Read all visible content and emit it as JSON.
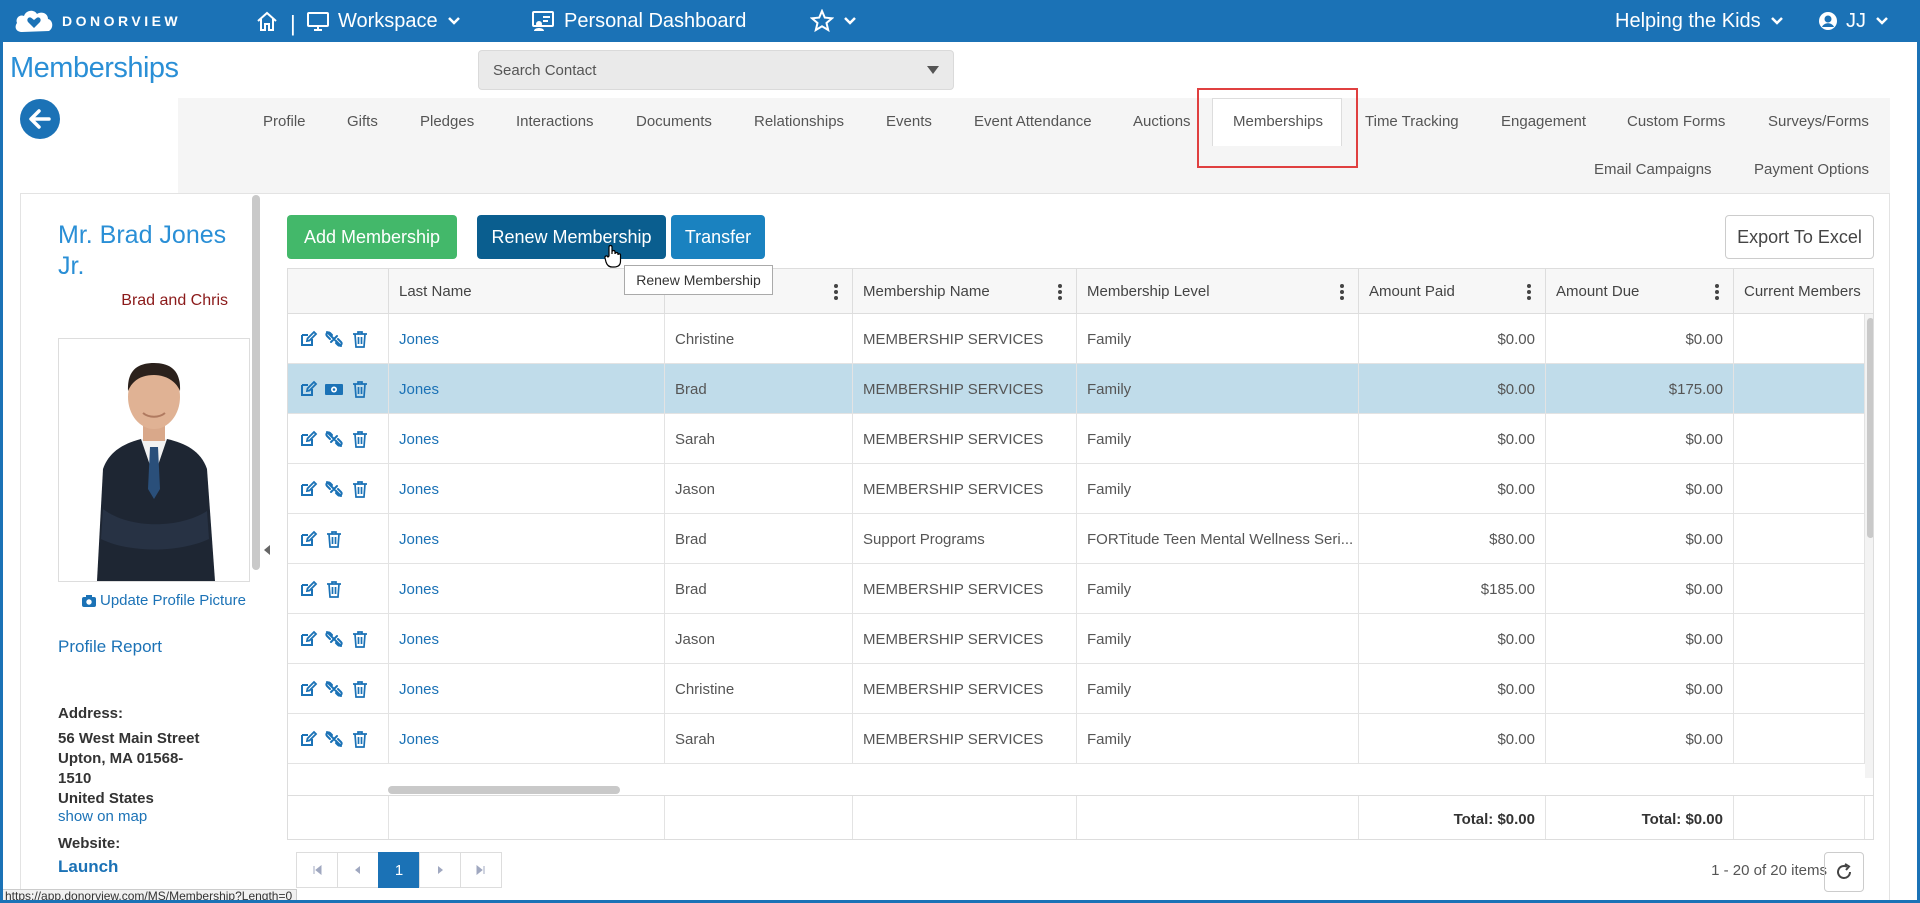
{
  "app": {
    "logo_text": "DONORVIEW",
    "workspace_label": "Workspace",
    "dashboard_label": "Personal Dashboard",
    "org_name": "Helping the Kids",
    "user_initials": "JJ",
    "separator": "|"
  },
  "page": {
    "title": "Memberships",
    "search_placeholder": "Search Contact"
  },
  "tabs": [
    {
      "label": "Profile"
    },
    {
      "label": "Gifts"
    },
    {
      "label": "Pledges"
    },
    {
      "label": "Interactions"
    },
    {
      "label": "Documents"
    },
    {
      "label": "Relationships"
    },
    {
      "label": "Events"
    },
    {
      "label": "Event Attendance"
    },
    {
      "label": "Auctions"
    },
    {
      "label": "Memberships"
    },
    {
      "label": "Time Tracking"
    },
    {
      "label": "Engagement"
    },
    {
      "label": "Custom Forms"
    },
    {
      "label": "Surveys/Forms"
    },
    {
      "label": "Email Campaigns"
    },
    {
      "label": "Payment Options"
    }
  ],
  "profile": {
    "name_line1": "Mr. Brad Jones",
    "name_line2": "Jr.",
    "nickname": "Brad and Chris",
    "update_picture": "Update Profile Picture",
    "profile_report": "Profile Report",
    "address_label": "Address:",
    "address_line1": "56 West Main Street",
    "address_line2": "Upton, MA 01568-",
    "address_line3": "1510",
    "address_line4": "United States",
    "show_on_map": "show on map",
    "website_label": "Website:",
    "website_link": "Launch"
  },
  "toolbar": {
    "add": "Add Membership",
    "renew": "Renew Membership",
    "transfer": "Transfer",
    "export": "Export To Excel",
    "tooltip": "Renew Membership"
  },
  "grid": {
    "headers": [
      "Last Name",
      "",
      "Membership Name",
      "Membership Level",
      "Amount Paid",
      "Amount Due",
      "Current Members"
    ],
    "rows": [
      {
        "icons": "edit-unlink-delete",
        "last": "Jones",
        "first": "Christine",
        "name": "MEMBERSHIP SERVICES",
        "level": "Family",
        "paid": "$0.00",
        "due": "$0.00"
      },
      {
        "icons": "edit-money-delete",
        "last": "Jones",
        "first": "Brad",
        "name": "MEMBERSHIP SERVICES",
        "level": "Family",
        "paid": "$0.00",
        "due": "$175.00",
        "selected": true
      },
      {
        "icons": "edit-unlink-delete",
        "last": "Jones",
        "first": "Sarah",
        "name": "MEMBERSHIP SERVICES",
        "level": "Family",
        "paid": "$0.00",
        "due": "$0.00"
      },
      {
        "icons": "edit-unlink-delete",
        "last": "Jones",
        "first": "Jason",
        "name": "MEMBERSHIP SERVICES",
        "level": "Family",
        "paid": "$0.00",
        "due": "$0.00"
      },
      {
        "icons": "edit-delete",
        "last": "Jones",
        "first": "Brad",
        "name": "Support Programs",
        "level": "FORTitude Teen Mental Wellness Seri...",
        "paid": "$80.00",
        "due": "$0.00"
      },
      {
        "icons": "edit-delete",
        "last": "Jones",
        "first": "Brad",
        "name": "MEMBERSHIP SERVICES",
        "level": "Family",
        "paid": "$185.00",
        "due": "$0.00"
      },
      {
        "icons": "edit-unlink-delete",
        "last": "Jones",
        "first": "Jason",
        "name": "MEMBERSHIP SERVICES",
        "level": "Family",
        "paid": "$0.00",
        "due": "$0.00"
      },
      {
        "icons": "edit-unlink-delete",
        "last": "Jones",
        "first": "Christine",
        "name": "MEMBERSHIP SERVICES",
        "level": "Family",
        "paid": "$0.00",
        "due": "$0.00"
      },
      {
        "icons": "edit-unlink-delete",
        "last": "Jones",
        "first": "Sarah",
        "name": "MEMBERSHIP SERVICES",
        "level": "Family",
        "paid": "$0.00",
        "due": "$0.00"
      }
    ],
    "footer_paid": "Total: $0.00",
    "footer_due": "Total: $0.00"
  },
  "pager": {
    "current_page": "1",
    "info": "1 - 20 of 20 items"
  },
  "status_bar": {
    "url": "https://app.donorview.com/MS/Membership?Length=0"
  }
}
